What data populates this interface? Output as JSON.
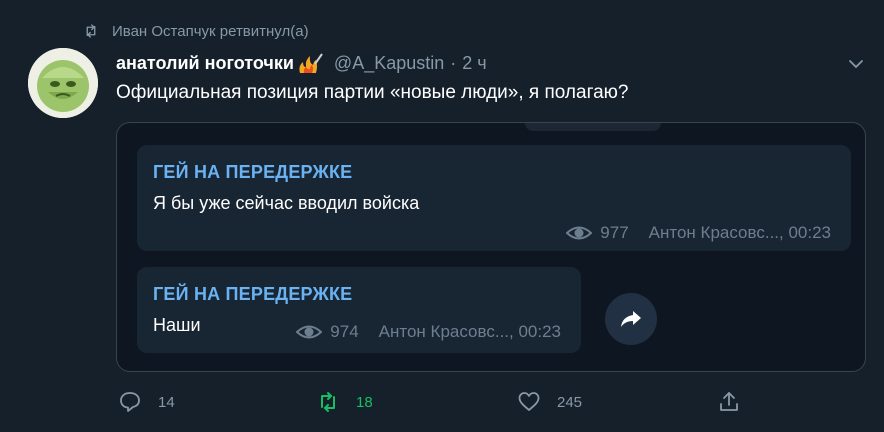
{
  "retweet": {
    "text": "Иван Остапчук ретвитнул(а)"
  },
  "tweet": {
    "name": "анатолий ноготочки",
    "handle": "@A_Kapustin",
    "separator": "·",
    "time": "2 ч",
    "text": "Официальная позиция партии «новые люди», я полагаю?"
  },
  "embedded": {
    "messages": [
      {
        "sender": "ГЕЙ НА ПЕРЕДЕРЖКЕ",
        "text": "Я бы уже сейчас вводил войска",
        "views": "977",
        "footer": "Антон Красовс..., 00:23"
      },
      {
        "sender": "ГЕЙ НА ПЕРЕДЕРЖКЕ",
        "text": "Наши",
        "views": "974",
        "footer": "Антон Красовс..., 00:23"
      }
    ]
  },
  "actions": {
    "replies": "14",
    "retweets": "18",
    "likes": "245"
  },
  "colors": {
    "background": "#15202b",
    "retweet_green": "#17bf63",
    "telegram_name": "#6ab2f2"
  }
}
